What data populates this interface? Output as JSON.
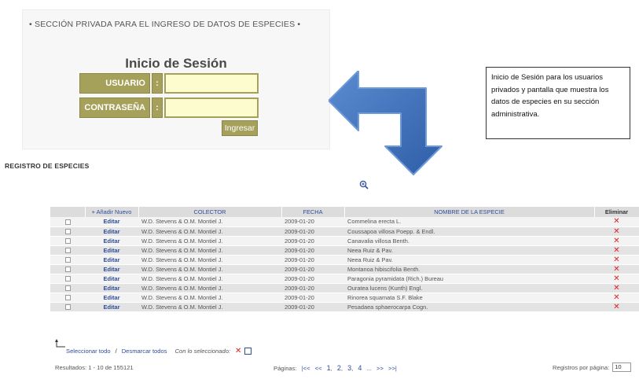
{
  "login": {
    "header": "• SECCIÓN PRIVADA PARA EL INGRESO DE DATOS DE ESPECIES •",
    "title": "Inicio de Sesión",
    "user_label": "USUARIO",
    "password_label": "CONTRASEÑA",
    "colon": ":",
    "user_value": "",
    "password_value": "",
    "submit_label": "Ingresar"
  },
  "note": {
    "text": "Inicio de Sesión para los usuarios privados y pantalla que muestra los datos de especies en su sección administrativa."
  },
  "registry": {
    "title": "REGISTRO DE ESPECIES",
    "columns": {
      "add_new": "+ Añadir Nuevo",
      "collector": "COLECTOR",
      "date": "FECHA",
      "species": "NOMBRE DE LA ESPECIE",
      "delete": "Eliminar"
    },
    "edit_label": "Editar",
    "delete_glyph": "✕",
    "rows": [
      {
        "collector": "W.D. Stevens & O.M. Montiel J.",
        "date": "2009-01-20",
        "species": "Commelina erecta L."
      },
      {
        "collector": "W.D. Stevens & O.M. Montiel J.",
        "date": "2009-01-20",
        "species": "Coussapoa villosa Poepp. & Endl."
      },
      {
        "collector": "W.D. Stevens & O.M. Montiel J.",
        "date": "2009-01-20",
        "species": "Canavalia villosa Benth."
      },
      {
        "collector": "W.D. Stevens & O.M. Montiel J.",
        "date": "2009-01-20",
        "species": "Neea Ruiz & Pav."
      },
      {
        "collector": "W.D. Stevens & O.M. Montiel J.",
        "date": "2009-01-20",
        "species": "Neea Ruiz & Pav."
      },
      {
        "collector": "W.D. Stevens & O.M. Montiel J.",
        "date": "2009-01-20",
        "species": "Montanoa hibiscifolia Benth."
      },
      {
        "collector": "W.D. Stevens & O.M. Montiel J.",
        "date": "2009-01-20",
        "species": "Paragonia pyramidata (Rich.) Bureau"
      },
      {
        "collector": "W.D. Stevens & O.M. Montiel J.",
        "date": "2009-01-20",
        "species": "Ouratea lucens (Kunth) Engl."
      },
      {
        "collector": "W.D. Stevens & O.M. Montiel J.",
        "date": "2009-01-20",
        "species": "Rinorea squamata S.F. Blake"
      },
      {
        "collector": "W.D. Stevens & O.M. Montiel J.",
        "date": "2009-01-20",
        "species": "Pesadaea sphaerocarpa Cogn."
      }
    ],
    "bulk": {
      "select_all": "Seleccionar todo",
      "separator": "/",
      "deselect_all": "Desmarcar todos",
      "with_selected": "Con lo seleccionado:",
      "delete_glyph": "✕"
    },
    "footer": {
      "results": "Resultados: 1 - 10 de 155121",
      "pages_label": "Páginas:",
      "first": "|<<",
      "prev": "<<",
      "pages": [
        "1",
        "2",
        "3",
        "4"
      ],
      "ellipsis": "...",
      "next": ">>",
      "last": ">>|",
      "per_page_label": "Registros por página:",
      "per_page_value": "10"
    }
  },
  "colors": {
    "olive_accent": "#a5a05a",
    "input_bg": "#fdfccf",
    "arrow_blue": "#3f6fb8",
    "link_blue": "#2e4d9a",
    "delete_red": "#dd2222"
  }
}
